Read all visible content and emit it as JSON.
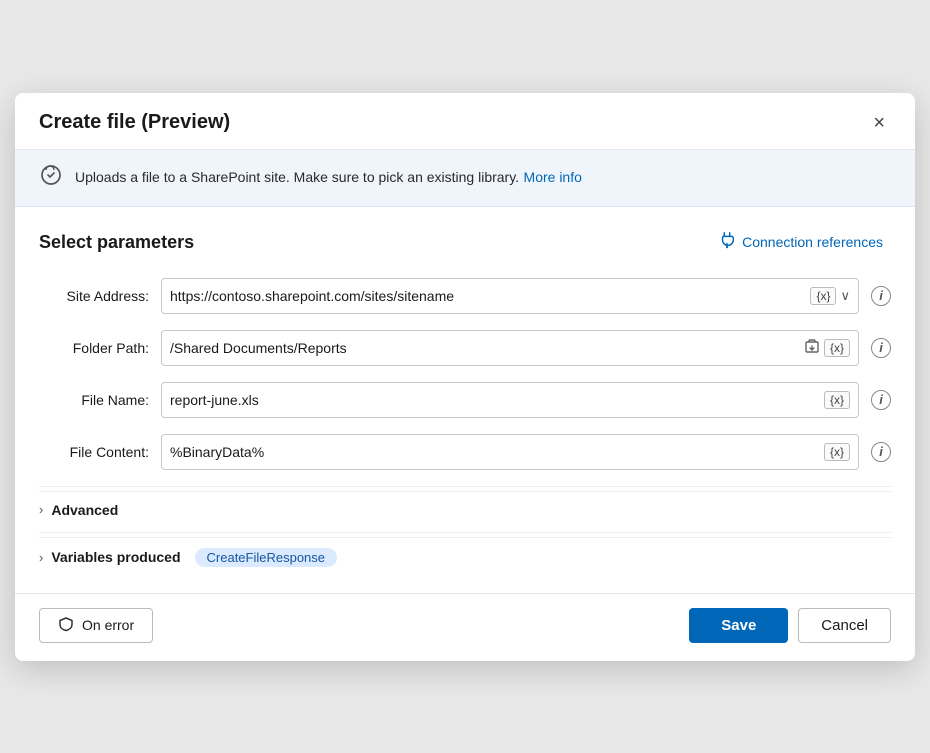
{
  "dialog": {
    "title": "Create file (Preview)",
    "close_label": "×"
  },
  "info_banner": {
    "text": "Uploads a file to a SharePoint site. Make sure to pick an existing library.",
    "link_text": "More info"
  },
  "section": {
    "title": "Select parameters",
    "connection_references_label": "Connection references"
  },
  "fields": [
    {
      "label": "Site Address:",
      "value": "https://contoso.sharepoint.com/sites/sitename",
      "has_dropdown": true,
      "has_var": true,
      "has_file_icon": false,
      "info": true
    },
    {
      "label": "Folder Path:",
      "value": "/Shared Documents/Reports",
      "has_dropdown": false,
      "has_var": true,
      "has_file_icon": true,
      "info": true
    },
    {
      "label": "File Name:",
      "value": "report-june.xls",
      "has_dropdown": false,
      "has_var": true,
      "has_file_icon": false,
      "info": true
    },
    {
      "label": "File Content:",
      "value": "%BinaryData%",
      "has_dropdown": false,
      "has_var": true,
      "has_file_icon": false,
      "info": true
    }
  ],
  "collapsible": [
    {
      "label": "Advanced",
      "has_variable": false
    },
    {
      "label": "Variables produced",
      "has_variable": true,
      "variable_name": "CreateFileResponse"
    }
  ],
  "footer": {
    "on_error_label": "On error",
    "save_label": "Save",
    "cancel_label": "Cancel"
  },
  "icons": {
    "close": "✕",
    "info_symbol": "i",
    "chevron_right": "›",
    "dropdown_arrow": "∨",
    "upload_icon": "⇪",
    "connection_icon": "⚡",
    "shield_icon": "🛡",
    "file_icon": "🗋",
    "plug_icon": "🔌"
  }
}
